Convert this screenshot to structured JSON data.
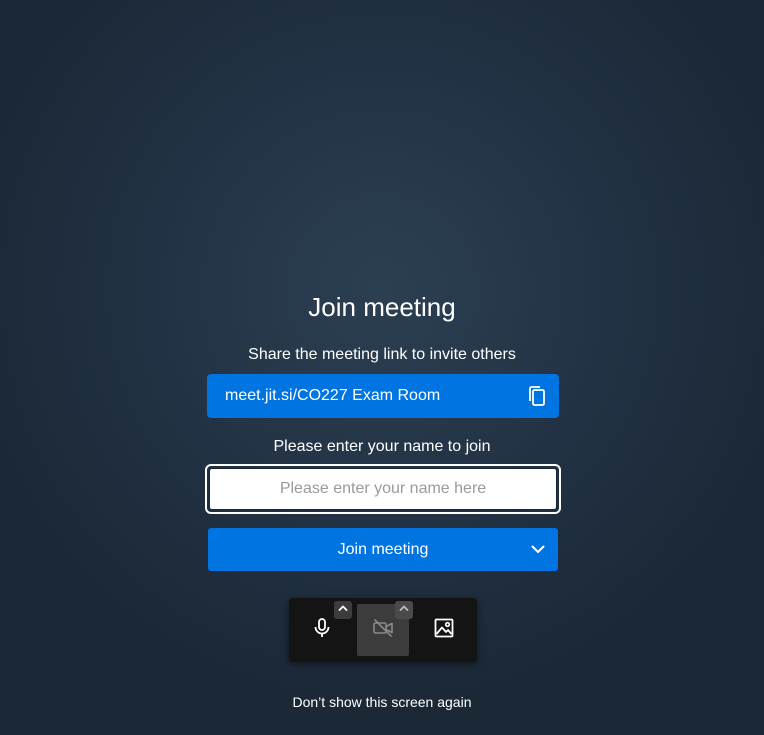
{
  "page": {
    "title": "Join meeting"
  },
  "share": {
    "label": "Share the meeting link to invite others",
    "link": "meet.jit.si/CO227 Exam Room",
    "copy_icon": "copy-icon"
  },
  "name": {
    "label": "Please enter your name to join",
    "placeholder": "Please enter your name here",
    "value": ""
  },
  "join": {
    "label": "Join meeting",
    "dropdown_icon": "chevron-down-icon"
  },
  "toolbar": {
    "microphone_icon": "microphone-icon",
    "camera_icon": "camera-off-icon",
    "background_icon": "image-icon",
    "caret_icon": "chevron-up-icon"
  },
  "footer": {
    "dont_show_label": "Don’t show this screen again"
  },
  "colors": {
    "accent": "#0074e0",
    "toolbar_bg": "#141414",
    "background": "#223244"
  }
}
